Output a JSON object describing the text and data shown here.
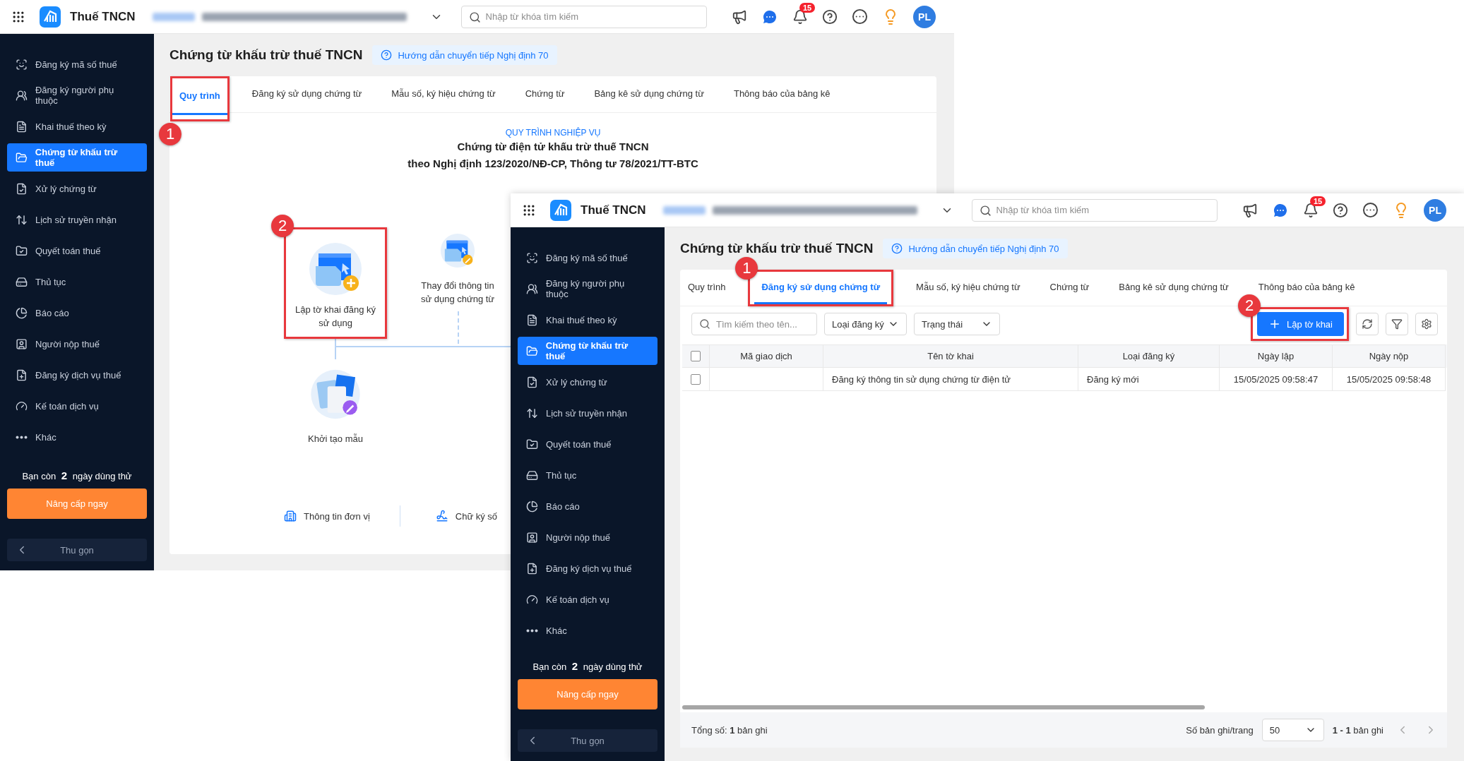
{
  "screens": [
    {
      "header": {
        "app_name": "Thuế TNCN",
        "search_placeholder": "Nhập từ khóa tìm kiếm",
        "notification_count": "15",
        "avatar_initials": "PL"
      },
      "sidebar": {
        "items": [
          {
            "label": "Đăng ký mã số thuế",
            "selected": false
          },
          {
            "label": "Đăng ký người phụ thuộc",
            "selected": false
          },
          {
            "label": "Khai thuế theo kỳ",
            "selected": false
          },
          {
            "label": "Chứng từ khấu trừ thuế",
            "selected": true
          },
          {
            "label": "Xử lý chứng từ",
            "selected": false
          },
          {
            "label": "Lịch sử truyền nhận",
            "selected": false
          },
          {
            "label": "Quyết toán thuế",
            "selected": false
          },
          {
            "label": "Thủ tục",
            "selected": false
          },
          {
            "label": "Báo cáo",
            "selected": false
          },
          {
            "label": "Người nộp thuế",
            "selected": false
          },
          {
            "label": "Đăng ký dịch vụ thuế",
            "selected": false
          },
          {
            "label": "Kế toán dịch vụ",
            "selected": false
          },
          {
            "label": "Khác",
            "selected": false
          }
        ],
        "trial_text": "Bạn còn **2** ngày dùng thử",
        "upgrade_button": "Nâng cấp ngay",
        "collapse_button": "Thu gọn"
      },
      "page": {
        "title": "Chứng từ khấu trừ thuế TNCN",
        "guide_link": "Hướng dẫn chuyển tiếp Nghị định 70",
        "tabs": [
          {
            "label": "Quy trình",
            "selected": true,
            "callout": "1"
          },
          {
            "label": "Đăng ký sử dụng chứng từ",
            "selected": false
          },
          {
            "label": "Mẫu số, ký hiệu chứng từ",
            "selected": false
          },
          {
            "label": "Chứng từ",
            "selected": false
          },
          {
            "label": "Bảng kê sử dụng chứng từ",
            "selected": false
          },
          {
            "label": "Thông báo của bảng kê",
            "selected": false
          }
        ],
        "content": {
          "kind": "workflow",
          "heading": "QUY TRÌNH NGHIỆP VỤ",
          "title_lines": [
            "Chứng từ điện tử khấu trừ thuế TNCN",
            "theo Nghị định 123/2020/NĐ-CP, Thông tư 78/2021/TT-BTC"
          ],
          "nodes": [
            {
              "kind": "register",
              "label": "Lập tờ khai đăng ký sử dụng",
              "callout": "2"
            },
            {
              "kind": "update",
              "label": "Thay đổi thông tin sử dụng chứng từ"
            },
            {
              "kind": "template",
              "label": "Khởi tạo mẫu"
            }
          ],
          "footer_links": [
            {
              "kind": "organization",
              "label": "Thông tin đơn vị"
            },
            {
              "kind": "signature",
              "label": "Chữ ký số"
            }
          ]
        }
      }
    },
    {
      "header": {
        "app_name": "Thuế TNCN",
        "search_placeholder": "Nhập từ khóa tìm kiếm",
        "notification_count": "15",
        "avatar_initials": "PL"
      },
      "sidebar": {
        "items": [
          {
            "label": "Đăng ký mã số thuế",
            "selected": false
          },
          {
            "label": "Đăng ký người phụ thuộc",
            "selected": false
          },
          {
            "label": "Khai thuế theo kỳ",
            "selected": false
          },
          {
            "label": "Chứng từ khấu trừ thuế",
            "selected": true
          },
          {
            "label": "Xử lý chứng từ",
            "selected": false
          },
          {
            "label": "Lịch sử truyền nhận",
            "selected": false
          },
          {
            "label": "Quyết toán thuế",
            "selected": false
          },
          {
            "label": "Thủ tục",
            "selected": false
          },
          {
            "label": "Báo cáo",
            "selected": false
          },
          {
            "label": "Người nộp thuế",
            "selected": false
          },
          {
            "label": "Đăng ký dịch vụ thuế",
            "selected": false
          },
          {
            "label": "Kế toán dịch vụ",
            "selected": false
          },
          {
            "label": "Khác",
            "selected": false
          }
        ],
        "trial_text": "Bạn còn **2** ngày dùng thử",
        "upgrade_button": "Nâng cấp ngay",
        "collapse_button": "Thu gọn"
      },
      "page": {
        "title": "Chứng từ khấu trừ thuế TNCN",
        "guide_link": "Hướng dẫn chuyển tiếp Nghị định 70",
        "tabs": [
          {
            "label": "Quy trình",
            "selected": false
          },
          {
            "label": "Đăng ký sử dụng chứng từ",
            "selected": true,
            "callout": "1"
          },
          {
            "label": "Mẫu số, ký hiệu chứng từ",
            "selected": false
          },
          {
            "label": "Chứng từ",
            "selected": false
          },
          {
            "label": "Bảng kê sử dụng chứng từ",
            "selected": false
          },
          {
            "label": "Thông báo của bảng kê",
            "selected": false
          }
        ],
        "content": {
          "kind": "table",
          "search_placeholder": "Tìm kiếm theo tên...",
          "filters": [
            "Loại đăng ký",
            "Trạng thái"
          ],
          "create_button": {
            "label": "Lập tờ khai",
            "callout": "2"
          },
          "select_all_checked": false,
          "columns": [
            "Mã giao dịch",
            "Tên tờ khai",
            "Loại đăng ký",
            "Ngày lập",
            "Ngày nộp"
          ],
          "rows": [
            {
              "checked": false,
              "cells": [
                "",
                "Đăng ký thông tin sử dụng chứng từ điện tử",
                "Đăng ký mới",
                "15/05/2025 09:58:47",
                "15/05/2025 09:58:48"
              ]
            }
          ],
          "footer": {
            "total": "Tổng số: **1** bản ghi",
            "page_size_label": "Số bản ghi/trang",
            "page_size": "50",
            "range": "**1 - 1** bản ghi"
          }
        }
      }
    }
  ]
}
